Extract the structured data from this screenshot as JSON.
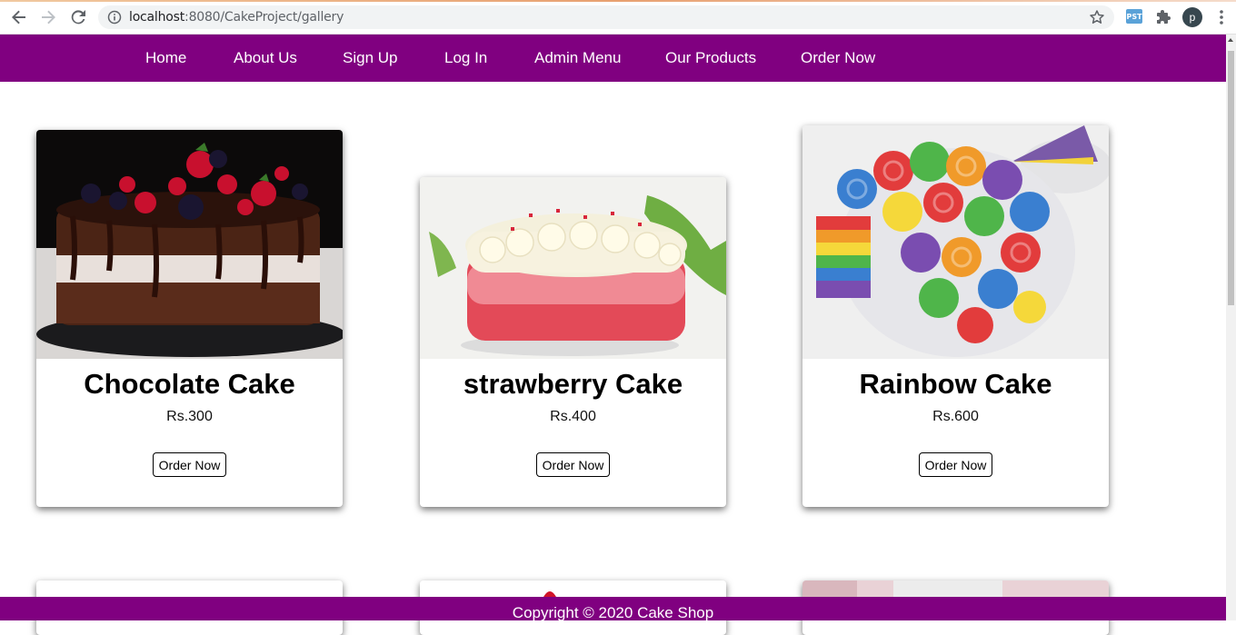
{
  "browser": {
    "url_host": "localhost",
    "url_rest": ":8080/CakeProject/gallery",
    "profile_initial": "p",
    "ext_label": "PST"
  },
  "nav": {
    "items": [
      "Home",
      "About Us",
      "Sign Up",
      "Log In",
      "Admin Menu",
      "Our Products",
      "Order Now"
    ],
    "bg_color": "#800080"
  },
  "products": [
    {
      "name": "Chocolate Cake",
      "price": "Rs.300",
      "button": "Order Now"
    },
    {
      "name": "strawberry Cake",
      "price": "Rs.400",
      "button": "Order Now"
    },
    {
      "name": "Rainbow Cake",
      "price": "Rs.600",
      "button": "Order Now"
    }
  ],
  "footer": {
    "text": "Copyright © 2020 Cake Shop"
  }
}
